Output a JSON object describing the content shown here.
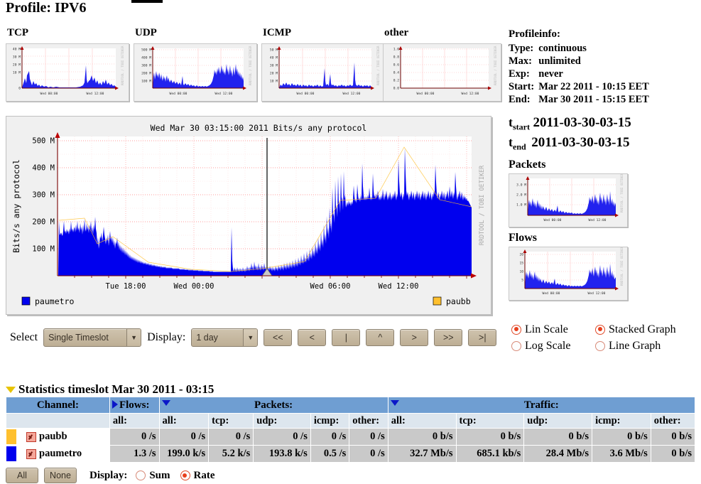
{
  "page": {
    "profile_title": "Profile: IPV6"
  },
  "protocols": [
    {
      "label": "TCP",
      "yticks": [
        "40 M",
        "30 M",
        "20 M",
        "10 M",
        "0"
      ],
      "xticks": [
        "Wed 00:00",
        "Wed 12:00"
      ],
      "watermark": "RRDTOOL / TOBI OETIKER"
    },
    {
      "label": "UDP",
      "yticks": [
        "500 M",
        "400 M",
        "300 M",
        "200 M",
        "100 M"
      ],
      "xticks": [
        "Wed 00:00",
        "Wed 12:00"
      ],
      "watermark": "RRDTOOL / TOBI OETIKER"
    },
    {
      "label": "ICMP",
      "yticks": [
        "50 M",
        "40 M",
        "30 M",
        "20 M",
        "10 M"
      ],
      "xticks": [
        "Wed 00:00",
        "Wed 12:00"
      ],
      "watermark": "RRDTOOL / TOBI OETIKER"
    },
    {
      "label": "other",
      "yticks": [
        "1.0",
        "0.8",
        "0.6",
        "0.4",
        "0.2",
        "0.0"
      ],
      "xticks": [
        "Wed 00:00",
        "Wed 12:00"
      ],
      "watermark": "RRDTOOL / TOBI OETIKER"
    }
  ],
  "main_graph": {
    "title": "Wed Mar 30 03:15:00 2011 Bits/s any protocol",
    "ylabel": "Bits/s any protocol",
    "watermark": "RRDTOOL / TOBI OETIKER",
    "yticks": [
      "500 M",
      "400 M",
      "300 M",
      "200 M",
      "100 M"
    ],
    "xticks": [
      "Tue 18:00",
      "Wed 00:00",
      "Wed 06:00",
      "Wed 12:00"
    ],
    "legend": [
      {
        "name": "paumetro",
        "color": "#0000ee"
      },
      {
        "name": "paubb",
        "color": "#ffc02e"
      }
    ]
  },
  "chart_data": {
    "type": "area",
    "title": "Wed Mar 30 03:15:00 2011 Bits/s any protocol",
    "xlabel": "",
    "ylabel": "Bits/s any protocol",
    "ylim": [
      0,
      530000000
    ],
    "ytick_values": [
      100000000,
      200000000,
      300000000,
      400000000,
      500000000
    ],
    "ytick_labels": [
      "100 M",
      "200 M",
      "300 M",
      "400 M",
      "500 M"
    ],
    "xtick_labels": [
      "Tue 18:00",
      "Wed 00:00",
      "Wed 06:00",
      "Wed 12:00"
    ],
    "grid": true,
    "legend_position": "bottom",
    "cursor_marker_x_label": "Wed Mar 30 03:15",
    "series": [
      {
        "name": "paumetro",
        "color": "#0000ee",
        "unit": "bits/s",
        "values_millions": [
          198,
          150,
          155,
          162,
          148,
          210,
          160,
          168,
          152,
          170,
          158,
          166,
          150,
          174,
          152,
          210,
          168,
          150,
          158,
          146,
          182,
          150,
          200,
          162,
          148,
          220,
          158,
          110,
          128,
          96,
          108,
          130,
          150,
          104,
          96,
          118,
          160,
          104,
          98,
          110,
          94,
          164,
          112,
          100,
          92,
          104,
          88,
          96,
          90,
          84,
          96,
          78,
          70,
          86,
          66,
          74,
          64,
          72,
          58,
          66,
          54,
          62,
          50,
          60,
          46,
          58,
          44,
          56,
          42,
          54,
          40,
          148,
          48,
          40,
          56,
          44,
          58,
          46,
          50,
          44,
          52,
          42,
          90,
          48,
          44,
          54,
          40,
          50,
          38,
          48,
          36,
          46,
          34,
          48,
          36,
          50,
          38,
          44,
          36,
          42,
          34,
          40,
          32,
          44,
          34,
          60,
          40,
          48,
          36,
          44,
          38,
          42,
          34,
          44,
          36,
          46,
          34,
          44,
          36,
          42,
          34,
          40,
          38,
          44,
          36,
          42,
          40,
          38,
          36,
          44,
          38,
          42,
          36,
          40,
          44,
          38,
          46,
          40,
          48,
          42,
          50,
          44,
          52,
          46,
          58,
          50,
          64,
          56,
          72,
          64,
          84,
          76,
          96,
          88,
          104,
          100,
          150,
          120,
          180,
          140,
          300,
          200,
          270,
          220,
          330,
          240,
          230,
          250,
          260,
          240,
          280,
          250,
          220,
          260,
          240,
          230,
          300,
          250,
          280,
          260,
          330,
          270,
          240,
          250,
          230,
          240,
          260,
          230,
          250,
          240,
          270,
          250,
          420,
          300,
          280,
          260,
          250,
          240,
          230,
          250,
          240,
          260,
          250,
          240,
          230,
          220,
          240,
          230,
          200,
          215,
          205,
          195,
          210,
          200,
          190,
          205,
          195,
          200,
          210,
          190,
          200,
          195,
          210,
          200,
          270,
          310,
          250,
          230,
          260,
          240,
          250,
          235,
          245,
          230,
          250,
          240,
          330,
          280,
          260,
          250,
          240,
          250,
          230,
          240,
          250,
          230,
          240,
          235,
          245,
          230,
          240,
          235,
          230,
          220,
          210,
          200
        ]
      },
      {
        "name": "paubb",
        "color": "#ffc02e",
        "unit": "bits/s",
        "values_millions": [
          0
        ]
      }
    ]
  },
  "profileinfo": {
    "heading": "Profileinfo:",
    "rows": [
      {
        "key": "Type:",
        "value": "continuous"
      },
      {
        "key": "Max:",
        "value": "unlimited"
      },
      {
        "key": "Exp:",
        "value": "never"
      },
      {
        "key": "Start:",
        "value": "Mar 22 2011 - 10:15 EET"
      },
      {
        "key": "End:",
        "value": "Mar 30 2011 - 15:15 EET"
      }
    ],
    "t_start_label": "t",
    "t_start_sub": "start",
    "t_start_value": "2011-03-30-03-15",
    "t_end_label": "t",
    "t_end_sub": "end",
    "t_end_value": "2011-03-30-03-15"
  },
  "side_graphs": [
    {
      "title": "Packets",
      "yticks": [
        "3.0 M",
        "2.0 M",
        "1.0 M"
      ],
      "xticks": [
        "Wed 00:00",
        "Wed 12:00"
      ],
      "watermark": "RRDTOOL / TOBI OETIKER"
    },
    {
      "title": "Flows",
      "yticks": [
        "20",
        "15",
        "10",
        "5"
      ],
      "xticks": [
        "Wed 00:00",
        "Wed 12:00"
      ],
      "watermark": "RRDTOOL / TOBI OETIKER"
    }
  ],
  "controls": {
    "select_label": "Select",
    "select_value": "Single Timeslot",
    "display_label": "Display:",
    "display_value": "1 day",
    "buttons": [
      "<<",
      "<",
      "|",
      "^",
      ">",
      ">>",
      ">|"
    ]
  },
  "scale_options": [
    {
      "label": "Lin Scale",
      "selected": true
    },
    {
      "label": "Stacked Graph",
      "selected": true
    },
    {
      "label": "Log Scale",
      "selected": false
    },
    {
      "label": "Line Graph",
      "selected": false
    }
  ],
  "statistics": {
    "heading": "Statistics timeslot Mar 30 2011 - 03:15",
    "groups": [
      {
        "label": "Channel:",
        "span": 1
      },
      {
        "label": "Flows:",
        "span": 1
      },
      {
        "label": "Packets:",
        "span": 5
      },
      {
        "label": "Traffic:",
        "span": 5
      }
    ],
    "subheaders": [
      "",
      "all:",
      "all:",
      "tcp:",
      "udp:",
      "icmp:",
      "other:",
      "all:",
      "tcp:",
      "udp:",
      "icmp:",
      "other:"
    ],
    "rows": [
      {
        "channel": "paubb",
        "color": "#ffc02e",
        "checked": true,
        "cells": [
          "0 /s",
          "0 /s",
          "0 /s",
          "0 /s",
          "0 /s",
          "0 /s",
          "0 b/s",
          "0 b/s",
          "0 b/s",
          "0 b/s",
          "0 b/s"
        ]
      },
      {
        "channel": "paumetro",
        "color": "#0000ee",
        "checked": true,
        "cells": [
          "1.3 /s",
          "199.0 k/s",
          "5.2 k/s",
          "193.8 k/s",
          "0.5 /s",
          "0 /s",
          "32.7 Mb/s",
          "685.1 kb/s",
          "28.4 Mb/s",
          "3.6 Mb/s",
          "0 b/s"
        ]
      }
    ],
    "all_button": "All",
    "none_button": "None",
    "display_label": "Display:",
    "sum_label": "Sum",
    "rate_label": "Rate",
    "sum_selected": false,
    "rate_selected": true
  }
}
